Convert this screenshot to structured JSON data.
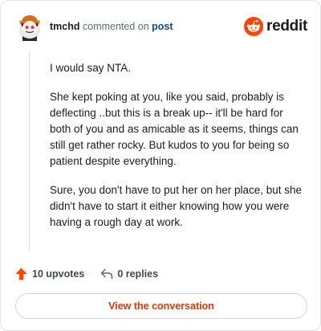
{
  "header": {
    "username": "tmchd",
    "commented_text": "commented on",
    "post_link": "post",
    "brand": "reddit"
  },
  "comment": {
    "paragraphs": [
      "I would say NTA.",
      "She kept poking at you, like you said, probably is deflecting ..but this is a break up-- it'll be hard for both of you and as amicable as it seems, things can still get rather rocky. But kudos to you for being so patient despite everything.",
      "Sure, you don't have to put her on her place, but she didn't have to start it either knowing how you were having a rough day at work."
    ]
  },
  "actions": {
    "upvotes": "10 upvotes",
    "replies": "0 replies"
  },
  "cta": {
    "label": "View the conversation"
  },
  "colors": {
    "accent": "#ff4500",
    "cta_text": "#d93900",
    "link": "#0a4a9e"
  }
}
